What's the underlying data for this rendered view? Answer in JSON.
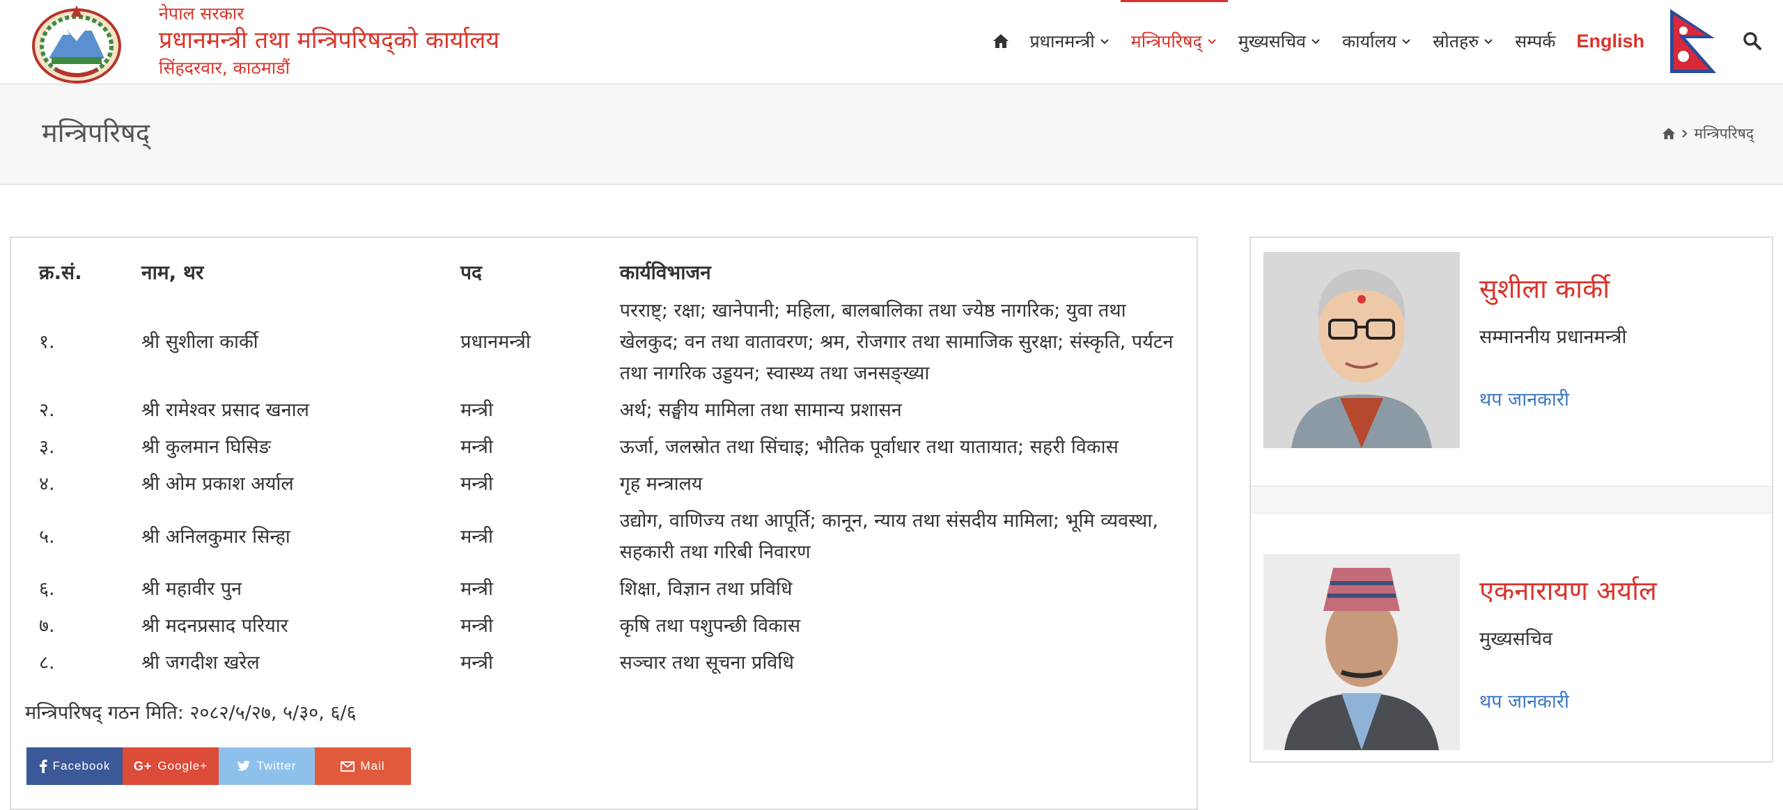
{
  "header": {
    "brand_small": "नेपाल सरकार",
    "brand_main": "प्रधानमन्त्री तथा मन्त्रिपरिषद्को कार्यालय",
    "brand_location": "सिंहदरवार, काठमाडौं",
    "nav": {
      "home_icon": "home-icon",
      "items": [
        {
          "label": "प्रधानमन्त्री",
          "has_dropdown": true
        },
        {
          "label": "मन्त्रिपरिषद्",
          "has_dropdown": true,
          "active": true
        },
        {
          "label": "मुख्यसचिव",
          "has_dropdown": true
        },
        {
          "label": "कार्यालय",
          "has_dropdown": true
        },
        {
          "label": "स्रोतहरु",
          "has_dropdown": true
        },
        {
          "label": "सम्पर्क",
          "has_dropdown": false
        }
      ],
      "language": "English",
      "flag_icon": "nepal-flag-icon",
      "search_icon": "search-icon"
    }
  },
  "titlebar": {
    "title": "मन्त्रिपरिषद्",
    "breadcrumb_current": "मन्त्रिपरिषद्"
  },
  "table": {
    "headers": {
      "sn": "क्र.सं.",
      "name": "नाम, थर",
      "post": "पद",
      "portfolio": "कार्यविभाजन"
    },
    "rows": [
      {
        "sn": "१.",
        "name": "श्री सुशीला कार्की",
        "post": "प्रधानमन्त्री",
        "portfolio": "परराष्ट्; रक्षा; खानेपानी; महिला, बालबालिका तथा ज्येष्ठ नागरिक; युवा तथा खेलकुद; वन तथा वातावरण; श्रम, रोजगार तथा सामाजिक सुरक्षा; संस्कृति, पर्यटन तथा नागरिक उड्डयन; स्वास्थ्य तथा जनसङ्ख्या"
      },
      {
        "sn": "२.",
        "name": "श्री रामेश्वर प्रसाद खनाल",
        "post": "मन्त्री",
        "portfolio": "अर्थ;  सङ्घीय मामिला तथा सामान्य प्रशासन"
      },
      {
        "sn": "३.",
        "name": "श्री कुलमान घिसिङ",
        "post": "मन्त्री",
        "portfolio": "ऊर्जा, जलस्रोत तथा सिंचाइ; भौतिक पूर्वाधार तथा यातायात; सहरी विकास"
      },
      {
        "sn": "४.",
        "name": "श्री ओम प्रकाश अर्याल",
        "post": "मन्त्री",
        "portfolio": "गृह मन्त्रालय"
      },
      {
        "sn": "५.",
        "name": "श्री अनिलकुमार सिन्हा",
        "post": "मन्त्री",
        "portfolio": "उद्योग, वाणिज्य तथा आपूर्ति; कानून, न्याय तथा संसदीय मामिला; भूमि व्यवस्था, सहकारी तथा गरिबी निवारण"
      },
      {
        "sn": "६.",
        "name": "श्री महावीर पुन",
        "post": "मन्त्री",
        "portfolio": "शिक्षा, विज्ञान तथा प्रविधि"
      },
      {
        "sn": "७.",
        "name": "श्री मदनप्रसाद परियार",
        "post": "मन्त्री",
        "portfolio": "कृषि तथा पशुपन्छी विकास"
      },
      {
        "sn": "८.",
        "name": "श्री जगदीश खरेल",
        "post": "मन्त्री",
        "portfolio": "सञ्चार तथा सूचना प्रविधि"
      }
    ],
    "formation_note": "मन्त्रिपरिषद् गठन मिति: २०८२/५/२७,  ५/३०, ६/६"
  },
  "share": {
    "buttons": [
      {
        "label": "Facebook",
        "icon": "facebook-icon",
        "color": "#3b5998"
      },
      {
        "label": "Google+",
        "icon": "google-plus-icon",
        "color": "#dd4b39"
      },
      {
        "label": "Twitter",
        "icon": "twitter-icon",
        "color": "#8ec0ec"
      },
      {
        "label": "Mail",
        "icon": "mail-icon",
        "color": "#e25a3c"
      }
    ]
  },
  "sidebar": {
    "cards": [
      {
        "name": "सुशीला कार्की",
        "role": "सम्माननीय प्रधानमन्त्री",
        "more": "थप जानकारी"
      },
      {
        "name": "एकनारायण अर्याल",
        "role": "मुख्यसचिव",
        "more": "थप जानकारी"
      }
    ]
  },
  "colors": {
    "accent": "#d9342b",
    "link": "#3a79c0",
    "text": "#333333"
  }
}
